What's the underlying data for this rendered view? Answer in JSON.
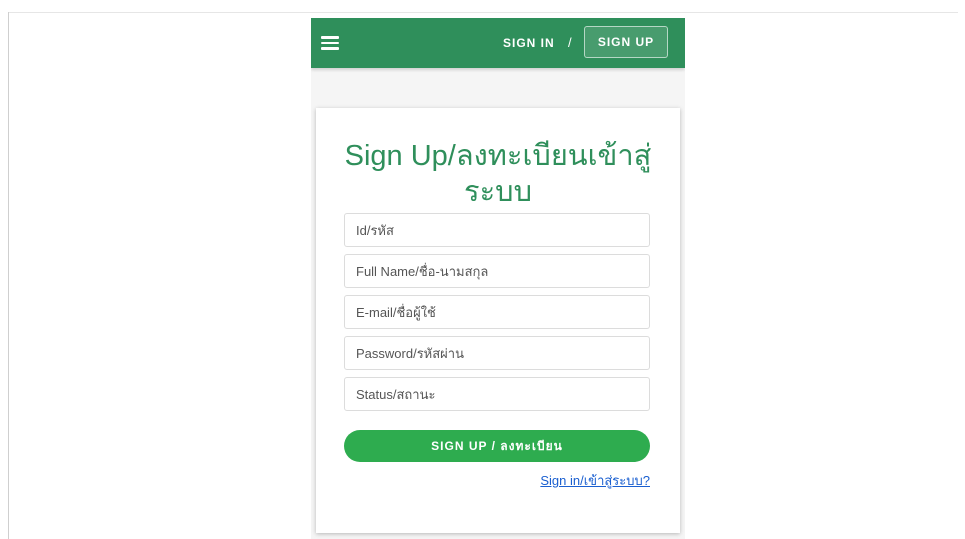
{
  "navbar": {
    "menu_icon": "hamburger-menu-icon",
    "signin_label": "SIGN IN",
    "separator": "/",
    "signup_label": "SIGN UP",
    "color": "#2f8f5b"
  },
  "form": {
    "title": "Sign Up/ลงทะเบียนเข้าสู่ระบบ",
    "fields": [
      {
        "placeholder": "Id/รหัส",
        "value": ""
      },
      {
        "placeholder": "Full Name/ชื่อ-นามสกุล",
        "value": ""
      },
      {
        "placeholder": "E-mail/ชื่อผู้ใช้",
        "value": ""
      },
      {
        "placeholder": "Password/รหัสผ่าน",
        "value": ""
      },
      {
        "placeholder": "Status/สถานะ",
        "value": ""
      }
    ],
    "submit_label": "SIGN UP / ลงทะเบียน",
    "submit_color": "#2eac4f",
    "signin_link": "Sign in/เข้าสู่ระบบ?"
  }
}
